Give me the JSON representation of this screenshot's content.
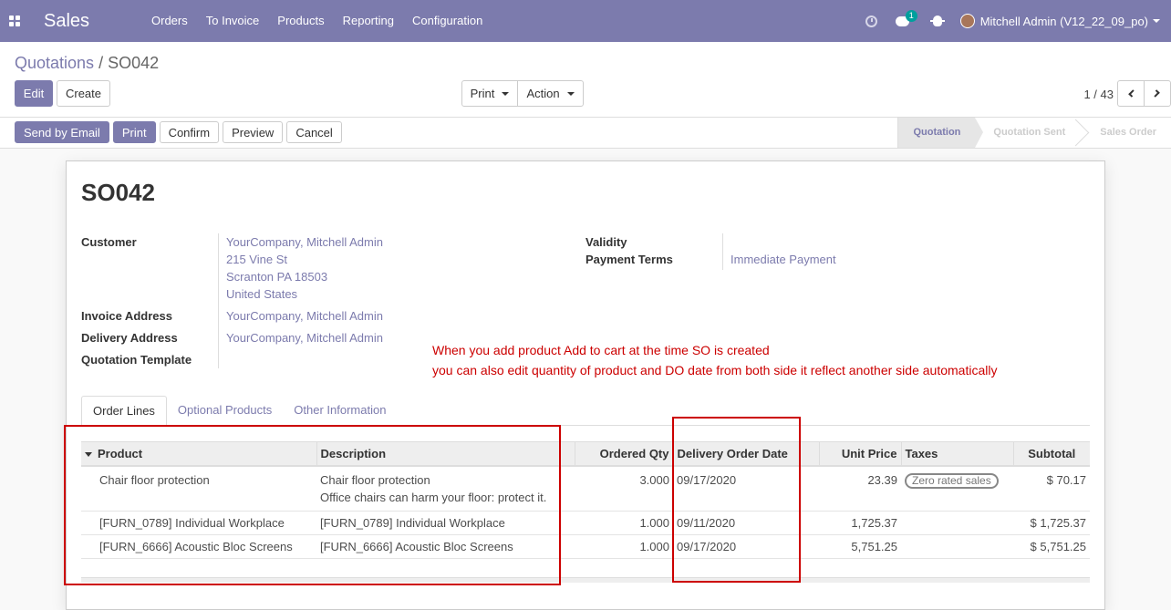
{
  "navbar": {
    "app_name": "Sales",
    "menu": [
      "Orders",
      "To Invoice",
      "Products",
      "Reporting",
      "Configuration"
    ],
    "chat_badge": "1",
    "user": "Mitchell Admin (V12_22_09_po)"
  },
  "control_panel": {
    "breadcrumb_parent": "Quotations",
    "breadcrumb_sep": "/",
    "breadcrumb_current": "SO042",
    "edit_label": "Edit",
    "create_label": "Create",
    "print_label": "Print",
    "action_label": "Action",
    "pager": "1 / 43"
  },
  "statusbar": {
    "buttons": [
      "Send by Email",
      "Print",
      "Confirm",
      "Preview",
      "Cancel"
    ],
    "stages": [
      "Quotation",
      "Quotation Sent",
      "Sales Order"
    ],
    "active_stage": "Quotation"
  },
  "form": {
    "name": "SO042",
    "customer_label": "Customer",
    "customer_lines": [
      "YourCompany, Mitchell Admin",
      "215 Vine St",
      "Scranton PA 18503",
      "United States"
    ],
    "invoice_address_label": "Invoice Address",
    "invoice_address": "YourCompany, Mitchell Admin",
    "delivery_address_label": "Delivery Address",
    "delivery_address": "YourCompany, Mitchell Admin",
    "quotation_template_label": "Quotation Template",
    "validity_label": "Validity",
    "payment_terms_label": "Payment Terms",
    "payment_terms": "Immediate Payment"
  },
  "annotation": {
    "line1": "When you add product Add to cart at the time SO is created",
    "line2": "you can also edit quantity of product and DO date from both side it reflect another side automatically"
  },
  "tabs": [
    "Order Lines",
    "Optional Products",
    "Other Information"
  ],
  "order_lines": {
    "columns": [
      "Product",
      "Description",
      "Ordered Qty",
      "Delivery Order Date",
      "Unit Price",
      "Taxes",
      "Subtotal"
    ],
    "rows": [
      {
        "product": "Chair floor protection",
        "description": "Chair floor protection",
        "description2": "Office chairs can harm your floor: protect it.",
        "qty": "3.000",
        "date": "09/17/2020",
        "price": "23.39",
        "tax": "Zero rated sales",
        "subtotal": "$ 70.17"
      },
      {
        "product": "[FURN_0789] Individual Workplace",
        "description": "[FURN_0789] Individual Workplace",
        "qty": "1.000",
        "date": "09/11/2020",
        "price": "1,725.37",
        "tax": "",
        "subtotal": "$ 1,725.37"
      },
      {
        "product": "[FURN_6666] Acoustic Bloc Screens",
        "description": "[FURN_6666] Acoustic Bloc Screens",
        "qty": "1.000",
        "date": "09/17/2020",
        "price": "5,751.25",
        "tax": "",
        "subtotal": "$ 5,751.25"
      }
    ]
  },
  "colors": {
    "brand": "#7c7bad",
    "annotation": "#cc0000"
  }
}
